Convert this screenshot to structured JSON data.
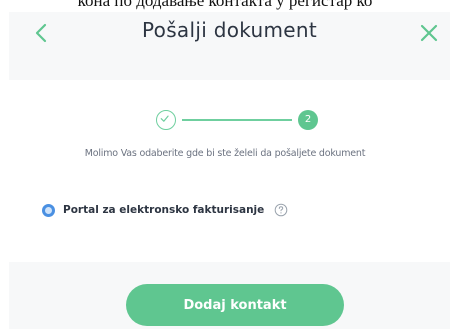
{
  "top_fragment": "кона по додавање контакта у регистар ко",
  "header": {
    "title": "Pošalji dokument",
    "back_icon": "chevron-left-icon",
    "close_icon": "close-icon",
    "accent_color": "#5fc690"
  },
  "stepper": {
    "completed_icon": "check-icon",
    "current_step": "2"
  },
  "instruction": "Molimo Vas odaberite gde bi ste želeli da pošaljete dokument",
  "option": {
    "label": "Portal za elektronsko fakturisanje",
    "selected": true,
    "help_icon": "question-circle-icon",
    "radio_color": "#4a90e2"
  },
  "footer": {
    "button_label": "Dodaj kontakt",
    "button_color": "#5fc690"
  }
}
